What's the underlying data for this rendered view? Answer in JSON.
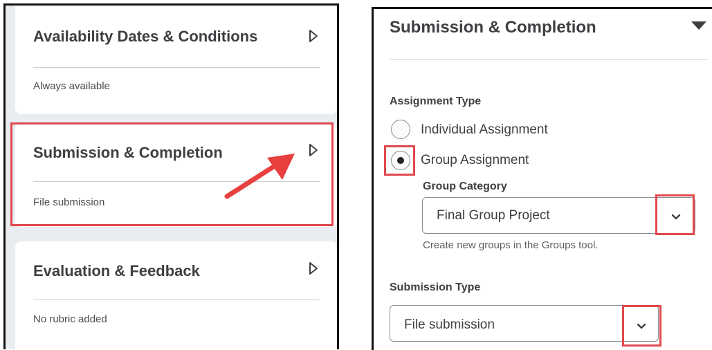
{
  "left_cards": [
    {
      "title": "Availability Dates & Conditions",
      "summary": "Always available"
    },
    {
      "title": "Submission & Completion",
      "summary": "File submission"
    },
    {
      "title": "Evaluation & Feedback",
      "summary": "No rubric added"
    }
  ],
  "panel": {
    "title": "Submission & Completion",
    "assignment_type": {
      "label": "Assignment Type",
      "options": [
        "Individual Assignment",
        "Group Assignment"
      ],
      "selected": "Group Assignment"
    },
    "group_category": {
      "label": "Group Category",
      "value": "Final Group Project",
      "help": "Create new groups in the Groups tool."
    },
    "submission_type": {
      "label": "Submission Type",
      "value": "File submission"
    }
  },
  "colors": {
    "highlight": "#e0484e",
    "arrow": "#e8403f"
  },
  "icons": {
    "expand": "triangle-right-icon",
    "collapse": "triangle-down-icon",
    "dropdown": "chevron-down-icon"
  }
}
